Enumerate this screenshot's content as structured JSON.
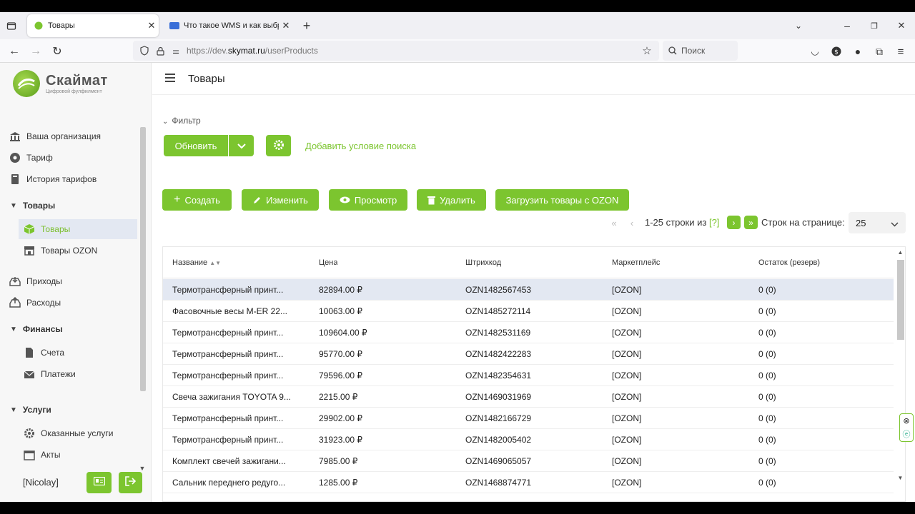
{
  "browser": {
    "tabs": [
      {
        "title": "Товары",
        "active": true
      },
      {
        "title": "Что такое WMS и как выбрать",
        "active": false
      }
    ],
    "url_prefix": "https://dev.",
    "url_domain": "skymat.ru",
    "url_path": "/userProducts",
    "search_placeholder": "Поиск"
  },
  "brand": {
    "name": "Скаймат",
    "tagline": "Цифровой фулфилмент"
  },
  "sidebar": {
    "items": [
      {
        "label": "Ваша организация",
        "icon": "bank-icon"
      },
      {
        "label": "Тариф",
        "icon": "gear-badge-icon"
      },
      {
        "label": "История тарифов",
        "icon": "book-icon"
      }
    ],
    "sections": [
      {
        "title": "Товары",
        "items": [
          {
            "label": "Товары",
            "icon": "box-icon"
          },
          {
            "label": "Товары OZON",
            "icon": "store-icon"
          }
        ]
      },
      {
        "title": "",
        "items": [
          {
            "label": "Приходы",
            "icon": "inbox-in-icon"
          },
          {
            "label": "Расходы",
            "icon": "inbox-out-icon"
          }
        ]
      },
      {
        "title": "Финансы",
        "items": [
          {
            "label": "Счета",
            "icon": "file-icon"
          },
          {
            "label": "Платежи",
            "icon": "envelope-icon"
          }
        ]
      },
      {
        "title": "Услуги",
        "items": [
          {
            "label": "Оказанные услуги",
            "icon": "cog-icon"
          },
          {
            "label": "Акты",
            "icon": "calendar-icon"
          }
        ]
      }
    ],
    "user": "[Nicolay]"
  },
  "page": {
    "title": "Товары"
  },
  "filter": {
    "label": "Фильтр",
    "refresh": "Обновить",
    "add_condition": "Добавить условие поиска"
  },
  "actions": {
    "create": "Создать",
    "edit": "Изменить",
    "view": "Просмотр",
    "delete": "Удалить",
    "import_ozon": "Загрузить товары с OZON"
  },
  "pagination": {
    "range": "1-25 строки из",
    "total": "[?]",
    "per_page_label": "Строк на странице:",
    "per_page": "25"
  },
  "table": {
    "columns": [
      "Название",
      "Цена",
      "Штрихкод",
      "Маркетплейс",
      "Остаток (резерв)"
    ],
    "rows": [
      [
        "Термотрансферный принт...",
        "82894.00 ₽",
        "OZN1482567453",
        "[OZON]",
        "0 (0)"
      ],
      [
        "Фасовочные весы M-ER 22...",
        "10063.00 ₽",
        "OZN1485272114",
        "[OZON]",
        "0 (0)"
      ],
      [
        "Термотрансферный принт...",
        "109604.00 ₽",
        "OZN1482531169",
        "[OZON]",
        "0 (0)"
      ],
      [
        "Термотрансферный принт...",
        "95770.00 ₽",
        "OZN1482422283",
        "[OZON]",
        "0 (0)"
      ],
      [
        "Термотрансферный принт...",
        "79596.00 ₽",
        "OZN1482354631",
        "[OZON]",
        "0 (0)"
      ],
      [
        "Свеча зажигания TOYOTA 9...",
        "2215.00 ₽",
        "OZN1469031969",
        "[OZON]",
        "0 (0)"
      ],
      [
        "Термотрансферный принт...",
        "29902.00 ₽",
        "OZN1482166729",
        "[OZON]",
        "0 (0)"
      ],
      [
        "Термотрансферный принт...",
        "31923.00 ₽",
        "OZN1482005402",
        "[OZON]",
        "0 (0)"
      ],
      [
        "Комплект свечей зажигани...",
        "7985.00 ₽",
        "OZN1469065057",
        "[OZON]",
        "0 (0)"
      ],
      [
        "Сальник переднего редуго...",
        "1285.00 ₽",
        "OZN1468874771",
        "[OZON]",
        "0 (0)"
      ]
    ]
  },
  "colors": {
    "accent": "#7cc52f",
    "selected_row": "#e3e8f2"
  }
}
